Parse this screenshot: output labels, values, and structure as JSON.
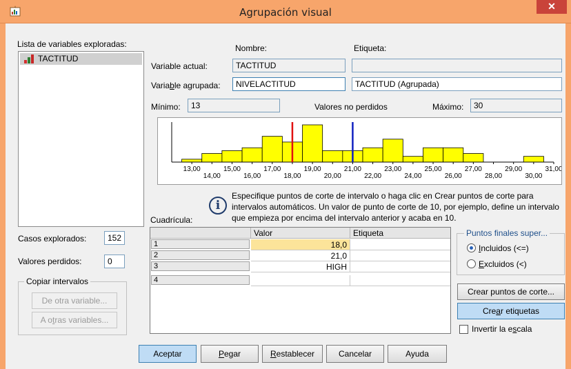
{
  "window": {
    "title": "Agrupación visual",
    "close_label": "✕"
  },
  "varlist": {
    "label": "Lista de variables exploradas:",
    "items": [
      "TACTITUD"
    ]
  },
  "headers": {
    "nombre": "Nombre:",
    "etiqueta": "Etiqueta:"
  },
  "current": {
    "label": "Variable actual:",
    "name": "TACTITUD",
    "label_value": ""
  },
  "grouped": {
    "label_pre": "Varia",
    "label_u": "b",
    "label_post": "le agrupada:",
    "name": "NIVELACTITUD",
    "label_value": "TACTITUD (Agrupada)"
  },
  "stats": {
    "min_label": "Mínimo:",
    "min": "13",
    "nonmissing_label": "Valores no perdidos",
    "max_label": "Máximo:",
    "max": "30"
  },
  "chart_data": {
    "type": "bar",
    "x": [
      13,
      14,
      15,
      16,
      17,
      18,
      19,
      20,
      21,
      22,
      23,
      24,
      25,
      26,
      27,
      28,
      29,
      30
    ],
    "values": [
      1,
      3,
      4,
      5,
      9,
      7,
      13,
      4,
      4,
      5,
      8,
      2,
      5,
      5,
      3,
      0,
      0,
      2
    ],
    "tick_labels_top": [
      "13,00",
      "15,00",
      "17,00",
      "19,00",
      "21,00",
      "23,00",
      "25,00",
      "27,00",
      "29,00",
      "31,00"
    ],
    "tick_labels_bottom": [
      "14,00",
      "16,00",
      "18,00",
      "20,00",
      "22,00",
      "24,00",
      "26,00",
      "28,00",
      "30,00"
    ],
    "xlim": [
      12,
      31
    ],
    "cut_points": [
      {
        "value": 18,
        "color": "#e01010"
      },
      {
        "value": 21,
        "color": "#1020c0"
      }
    ],
    "bar_color": "#ffff00"
  },
  "info": {
    "icon": "info-icon",
    "text": "Especifique puntos de corte de intervalo o haga clic en Crear puntos de corte para intervalos automáticos. Un valor de punto de corte de 10, por ejemplo, define un intervalo que empieza por encima del intervalo anterior y acaba en 10."
  },
  "grid": {
    "label": "Cuadrícula:",
    "columns": [
      "Valor",
      "Etiqueta"
    ],
    "rows": [
      {
        "num": "1",
        "valor": "18,0",
        "etiqueta": ""
      },
      {
        "num": "2",
        "valor": "21,0",
        "etiqueta": ""
      },
      {
        "num": "3",
        "valor": "HIGH",
        "etiqueta": ""
      },
      {
        "num": "4",
        "valor": "",
        "etiqueta": ""
      }
    ]
  },
  "cases": {
    "explored_label": "Casos explorados:",
    "explored": "152",
    "missing_label": "Valores perdidos:",
    "missing": "0"
  },
  "copy_group": {
    "legend": "Copiar intervalos",
    "from_label": "De otra variable...",
    "to_pre": "A o",
    "to_u": "t",
    "to_post": "ras variables..."
  },
  "endpoints": {
    "legend": "Puntos finales super...",
    "included": "Incluidos (<=)",
    "included_u": "I",
    "excluded": "Excluidos (<)",
    "excluded_u": "E"
  },
  "buttons": {
    "create_cuts": "Crear puntos de corte...",
    "create_labels_pre": "Cre",
    "create_labels_u": "a",
    "create_labels_post": "r etiquetas",
    "invert_pre": "Invertir la e",
    "invert_u": "s",
    "invert_post": "cala"
  },
  "footer": {
    "ok": "Aceptar",
    "paste_u": "P",
    "paste_rest": "egar",
    "reset_u": "R",
    "reset_rest": "establecer",
    "cancel": "Cancelar",
    "help": "Ayuda"
  }
}
